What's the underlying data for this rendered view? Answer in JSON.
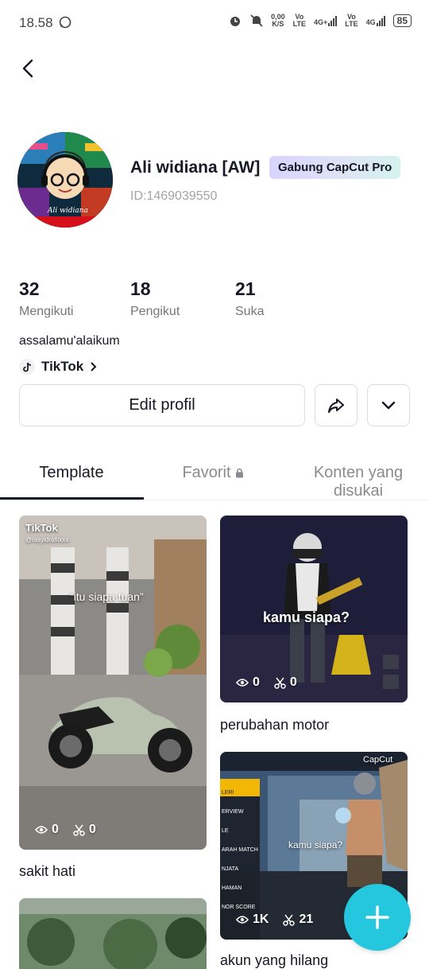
{
  "status_bar": {
    "time": "18.58",
    "speed": "0,00",
    "speed_unit": "K/S",
    "net1": "Vo",
    "net1_sub": "LTE",
    "net2": "4G+",
    "net3": "Vo",
    "net3_sub": "LTE",
    "net4": "4G",
    "battery": "85"
  },
  "profile": {
    "name": "Ali widiana [AW]",
    "badge": "Gabung CapCut Pro",
    "id": "ID:1469039550",
    "avatar_caption": "Ali widiana"
  },
  "stats": [
    {
      "count": "32",
      "label": "Mengikuti"
    },
    {
      "count": "18",
      "label": "Pengikut"
    },
    {
      "count": "21",
      "label": "Suka"
    }
  ],
  "bio": "assalamu'alaikum",
  "tiktok_link": "TikTok",
  "buttons": {
    "edit": "Edit profil"
  },
  "tabs": {
    "template": "Template",
    "favorit": "Favorit",
    "liked": "Konten yang disukai"
  },
  "templates": [
    {
      "title": "sakit hati",
      "views": "0",
      "uses": "0",
      "overlay": "“itu siapa tuan”",
      "watermark": "TikTok",
      "handle": "@rasyidrafiixxx"
    },
    {
      "title": "perubahan motor",
      "views": "0",
      "uses": "0",
      "overlay": "kamu siapa?"
    },
    {
      "title": "akun yang hilang",
      "views": "1K",
      "uses": "21",
      "overlay": "kamu siapa?",
      "brand": "CapCut",
      "menu": [
        "LERI",
        "ERVIEW",
        "LE",
        "ARAH MATCH",
        "NJATA",
        "HAMAN",
        "NOR SCORE"
      ]
    }
  ]
}
